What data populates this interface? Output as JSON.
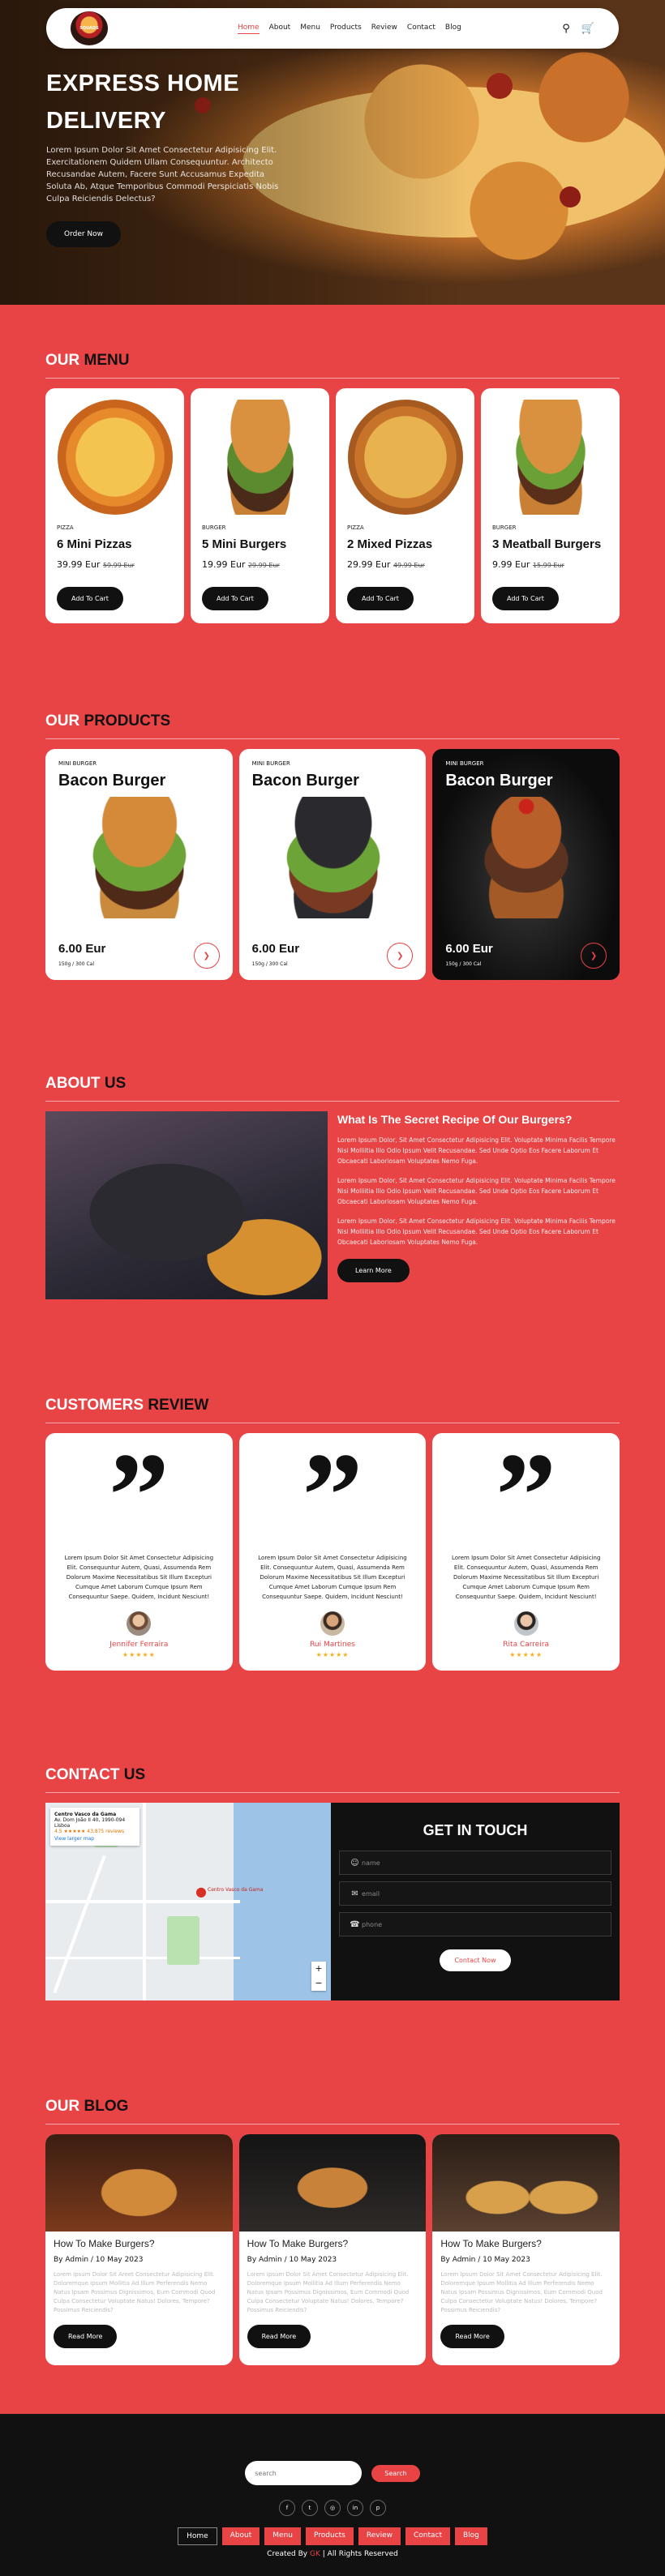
{
  "brand": {
    "accent": "#e84345",
    "dark": "#111111"
  },
  "nav": {
    "logo_text": "SQUADS",
    "links": [
      "Home",
      "About",
      "Menu",
      "Products",
      "Review",
      "Contact",
      "Blog"
    ],
    "active": "Home",
    "icons": [
      "search-icon",
      "cart-icon"
    ]
  },
  "hero": {
    "title_line1": "EXPRESS HOME",
    "title_line2": "DELIVERY",
    "text": "Lorem Ipsum Dolor Sit Amet Consectetur Adipisicing Elit. Exercitationem Quidem Ullam Consequuntur. Architecto Recusandae Autem, Facere Sunt Accusamus Expedita Soluta Ab, Atque Temporibus Commodi Perspiciatis Nobis Culpa Reiciendis Delectus?",
    "button": "Order Now"
  },
  "menu": {
    "title_a": "OUR",
    "title_b": "MENU",
    "items": [
      {
        "category": "PIZZA",
        "name": "6 Mini Pizzas",
        "price": "39.99 Eur",
        "old_price": "59.99 Eur",
        "button": "Add To Cart"
      },
      {
        "category": "BURGER",
        "name": "5 Mini Burgers",
        "price": "19.99 Eur",
        "old_price": "29.99 Eur",
        "button": "Add To Cart"
      },
      {
        "category": "PIZZA",
        "name": "2 Mixed Pizzas",
        "price": "29.99 Eur",
        "old_price": "49.99 Eur",
        "button": "Add To Cart"
      },
      {
        "category": "BURGER",
        "name": "3 Meatball Burgers",
        "price": "9.99 Eur",
        "old_price": "15.99 Eur",
        "button": "Add To Cart"
      }
    ]
  },
  "products": {
    "title_a": "OUR",
    "title_b": "PRODUCTS",
    "items": [
      {
        "category": "MINI BURGER",
        "name": "Bacon Burger",
        "price": "6.00 Eur",
        "meta": "150g / 300 Cal"
      },
      {
        "category": "MINI BURGER",
        "name": "Bacon Burger",
        "price": "6.00 Eur",
        "meta": "150g / 300 Cal"
      },
      {
        "category": "MINI BURGER",
        "name": "Bacon Burger",
        "price": "6.00 Eur",
        "meta": "150g / 300 Cal"
      }
    ]
  },
  "about": {
    "title_a": "ABOUT",
    "title_b": "US",
    "heading": "What Is The Secret Recipe Of Our Burgers?",
    "paragraphs": [
      "Lorem Ipsum Dolor, Sit Amet Consectetur Adipisicing Elit. Voluptate Minima Facilis Tempore Nisi Molliitia Illo Odio Ipsum Velit Recusandae. Sed Unde Optio Eos Facere Laborum Et Obcaecati Laboriosam Voluptates Nemo Fuga.",
      "Lorem Ipsum Dolor, Sit Amet Consectetur Adipisicing Elit. Voluptate Minima Facilis Tempore Nisi Molliitia Illo Odio Ipsum Velit Recusandae. Sed Unde Optio Eos Facere Laborum Et Obcaecati Laboriosam Voluptates Nemo Fuga.",
      "Lorem Ipsum Dolor, Sit Amet Consectetur Adipisicing Elit. Voluptate Minima Facilis Tempore Nisi Molliitia Illo Odio Ipsum Velit Recusandae. Sed Unde Optio Eos Facere Laborum Et Obcaecati Laboriosam Voluptates Nemo Fuga."
    ],
    "button": "Learn More"
  },
  "review": {
    "title_a": "CUSTOMERS",
    "title_b": "REVIEW",
    "items": [
      {
        "text": "Lorem Ipsum Dolor Sit Amet Consectetur Adipisicing Elit. Consequuntur Autem, Quasi, Assumenda Rem Dolorum Maxime Necessitatibus Sit Illum Excepturi Cumque Amet Laborum Cumque Ipsum Rem Consequuntur Saepe. Quidem, Incidunt Nesciunt!",
        "name": "Jennifer Ferraira",
        "stars": "★★★★★"
      },
      {
        "text": "Lorem Ipsum Dolor Sit Amet Consectetur Adipisicing Elit. Consequuntur Autem, Quasi, Assumenda Rem Dolorum Maxime Necessitatibus Sit Illum Excepturi Cumque Amet Laborum Cumque Ipsum Rem Consequuntur Saepe. Quidem, Incidunt Nesciunt!",
        "name": "Rui Martines",
        "stars": "★★★★★"
      },
      {
        "text": "Lorem Ipsum Dolor Sit Amet Consectetur Adipisicing Elit. Consequuntur Autem, Quasi, Assumenda Rem Dolorum Maxime Necessitatibus Sit Illum Excepturi Cumque Amet Laborum Cumque Ipsum Rem Consequuntur Saepe. Quidem, Incidunt Nesciunt!",
        "name": "Rita Carreira",
        "stars": "★★★★★"
      }
    ]
  },
  "contact": {
    "title_a": "CONTACT",
    "title_b": "US",
    "map": {
      "place": "Centro Vasco da Gama",
      "address": "Av. Dom João II 40, 1990-094 Lisboa",
      "rating": "4.5 ★★★★★ 43,875 reviews",
      "link": "View larger map",
      "pin_label": "Centro Vasco da Gama",
      "zoom_in": "+",
      "zoom_out": "−"
    },
    "heading": "GET IN TOUCH",
    "fields": [
      {
        "icon": "user-icon",
        "placeholder": "name"
      },
      {
        "icon": "envelope-icon",
        "placeholder": "email"
      },
      {
        "icon": "phone-icon",
        "placeholder": "phone"
      }
    ],
    "button": "Contact Now"
  },
  "blog": {
    "title_a": "OUR",
    "title_b": "BLOG",
    "items": [
      {
        "title": "How To Make Burgers?",
        "meta": "By Admin / 10 May 2023",
        "desc": "Lorem Ipsum Dolor Sit Amet Consectetur Adipisicing Elit. Doloremque Ipsum Mollitia Ad Illum Perferendis Nemo Natus Ipsam Possimus Dignissimos, Eum Commodi Quod Culpa Consectetur Voluptate Natus! Dolores, Tempore? Possimus Reiciendis?",
        "button": "Read More"
      },
      {
        "title": "How To Make Burgers?",
        "meta": "By Admin / 10 May 2023",
        "desc": "Lorem Ipsum Dolor Sit Amet Consectetur Adipisicing Elit. Doloremque Ipsum Mollitia Ad Illum Perferendis Nemo Natus Ipsam Possimus Dignissimos, Eum Commodi Quod Culpa Consectetur Voluptate Natus! Dolores, Tempore? Possimus Reiciendis?",
        "button": "Read More"
      },
      {
        "title": "How To Make Burgers?",
        "meta": "By Admin / 10 May 2023",
        "desc": "Lorem Ipsum Dolor Sit Amet Consectetur Adipisicing Elit. Doloremque Ipsum Mollitia Ad Illum Perferendis Nemo Natus Ipsam Possimus Dignissimos, Eum Commodi Quod Culpa Consectetur Voluptate Natus! Dolores, Tempore? Possimus Reiciendis?",
        "button": "Read More"
      }
    ]
  },
  "footer": {
    "search_placeholder": "search",
    "search_button": "Search",
    "social": [
      "facebook-icon",
      "twitter-icon",
      "instagram-icon",
      "linkedin-icon",
      "pinterest-icon"
    ],
    "social_glyphs": [
      "f",
      "t",
      "◎",
      "in",
      "p"
    ],
    "links": [
      "Home",
      "About",
      "Menu",
      "Products",
      "Review",
      "Contact",
      "Blog"
    ],
    "copy_pre": "Created By",
    "copy_name": "GK",
    "copy_post": "| All Rights Reserved"
  }
}
